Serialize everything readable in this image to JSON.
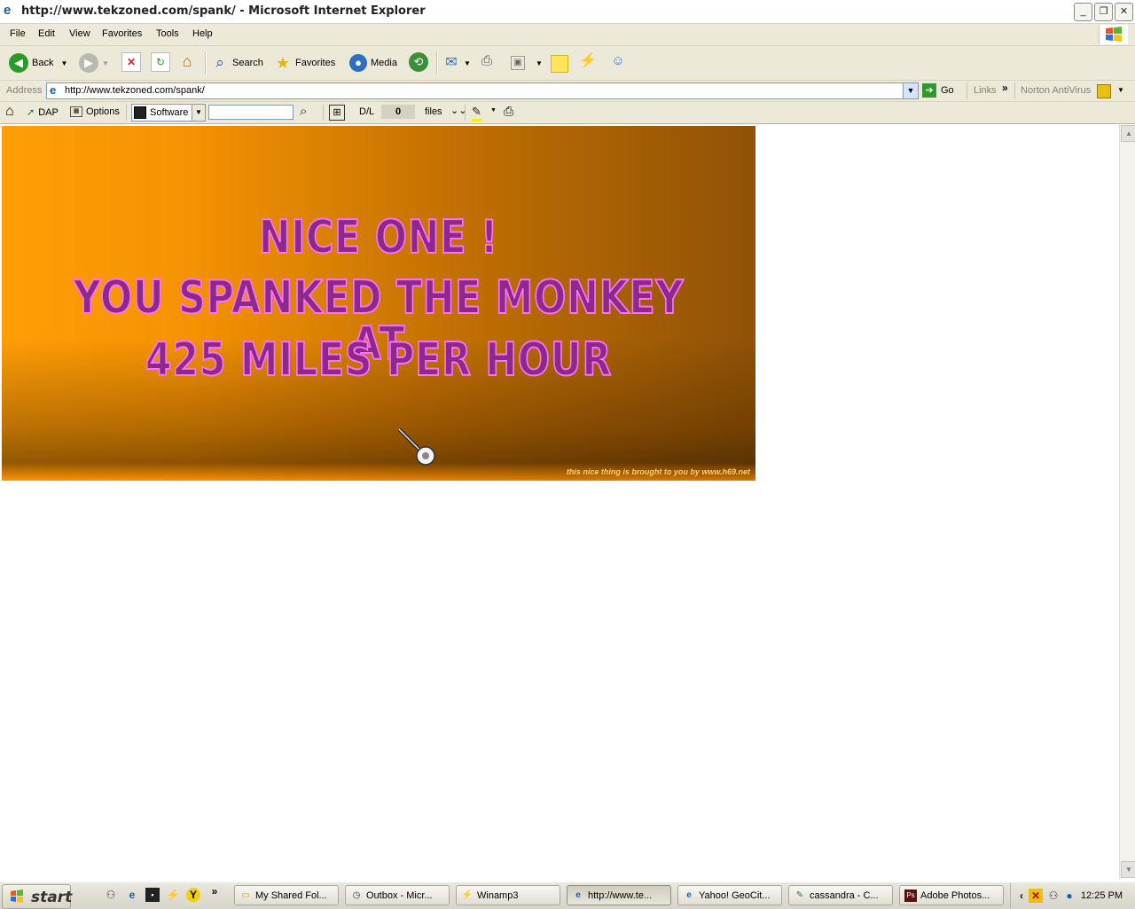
{
  "window": {
    "title": "http://www.tekzoned.com/spank/ - Microsoft Internet Explorer",
    "minimize": "_",
    "restore": "❐",
    "close": "✕"
  },
  "menu": [
    "File",
    "Edit",
    "View",
    "Favorites",
    "Tools",
    "Help"
  ],
  "toolbar": {
    "back": "Back",
    "search": "Search",
    "favorites": "Favorites",
    "media": "Media"
  },
  "address": {
    "label": "Address",
    "url": "http://www.tekzoned.com/spank/",
    "go": "Go",
    "links": "Links",
    "norton": "Norton AntiVirus"
  },
  "dap": {
    "dap_label": "DAP",
    "options_label": "Options",
    "category": "Software",
    "search_value": "",
    "dl_label": "D/L",
    "dl_count": "0",
    "files_label": "files"
  },
  "banner": {
    "line1": "NICE ONE !",
    "line2": "YOU SPANKED THE MONKEY AT",
    "line3": "425 MILES PER HOUR",
    "credit": "this nice thing is brought to you by www.h69.net"
  },
  "taskbar": {
    "start": "start",
    "tasks": [
      {
        "label": "My Shared Fol...",
        "icon": "folder-icon"
      },
      {
        "label": "Outbox - Micr...",
        "icon": "outlook-icon"
      },
      {
        "label": "Winamp3",
        "icon": "winamp-icon"
      },
      {
        "label": "http://www.te...",
        "icon": "ie-icon"
      },
      {
        "label": "Yahoo! GeoCit...",
        "icon": "ie-icon"
      },
      {
        "label": "cassandra - C...",
        "icon": "app-icon"
      },
      {
        "label": "Adobe Photos...",
        "icon": "photoshop-icon"
      }
    ],
    "clock": "12:25 PM"
  },
  "colors": {
    "banner_light": "#ff9e06",
    "banner_dark": "#8f5206",
    "banner_text": "#ff6fff",
    "chrome": "#ece9d8"
  }
}
